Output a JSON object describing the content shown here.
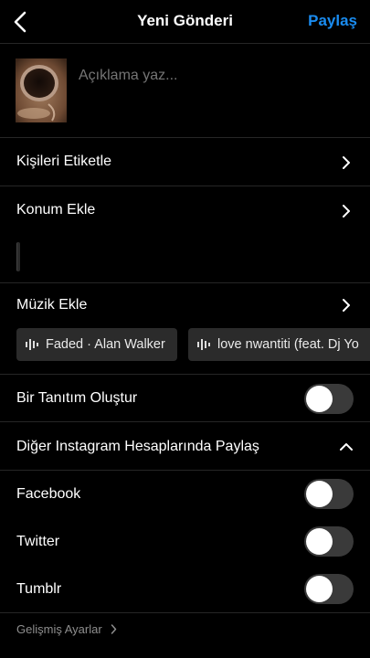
{
  "header": {
    "title": "Yeni Gönderi",
    "share_label": "Paylaş"
  },
  "caption": {
    "placeholder": "Açıklama yaz..."
  },
  "rows": {
    "tag_people": "Kişileri Etiketle",
    "add_location": "Konum Ekle",
    "add_music": "Müzik Ekle",
    "create_promotion": "Bir Tanıtım Oluştur",
    "share_other_accounts": "Diğer Instagram Hesaplarında Paylaş",
    "facebook": "Facebook",
    "twitter": "Twitter",
    "tumblr": "Tumblr"
  },
  "music_suggestions": [
    {
      "label": "Faded · Alan Walker"
    },
    {
      "label": "love nwantiti (feat. Dj Yo"
    }
  ],
  "toggles": {
    "create_promotion": false,
    "facebook": false,
    "twitter": false,
    "tumblr": false
  },
  "footer": {
    "advanced_settings": "Gelişmiş Ayarlar"
  },
  "colors": {
    "accent": "#1a8cf0",
    "background": "#000000",
    "divider": "#262626"
  },
  "icons": {
    "back": "chevron-left-icon",
    "row": "chevron-right-icon",
    "expand": "chevron-up-icon",
    "music": "waveform-icon"
  }
}
